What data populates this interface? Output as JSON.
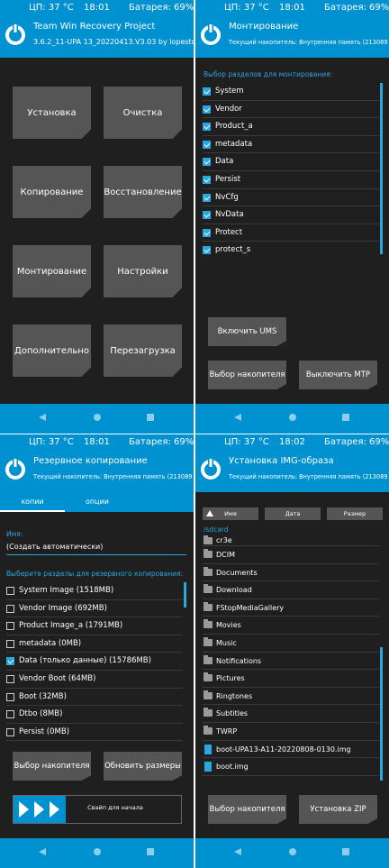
{
  "status": {
    "cpu": "ЦП: 37 °C",
    "battery": "Батарея: 69%",
    "battery_plus": "Батарея: 69%+",
    "time1": "18:01",
    "time2": "18:01",
    "time3": "18:01",
    "time4": "18:02"
  },
  "colors": {
    "accent": "#0091d1",
    "background": "#1f1f1f",
    "button": "#555555"
  },
  "main": {
    "title": "Team Win Recovery Project",
    "subtitle": "3.6.2_11-UPA 13_20220413.V3.03 by lopestom",
    "buttons": [
      "Установка",
      "Очистка",
      "Копирование",
      "Восстановление",
      "Монтирование",
      "Настройки",
      "Дополнительно",
      "Перезагрузка"
    ]
  },
  "mount": {
    "title": "Монтирование",
    "storage": "Текущий накопитель: Внутренняя память (213089 МБ)",
    "section_label": "Выбор разделов для монтирования:",
    "partitions": [
      "System",
      "Vendor",
      "Product_a",
      "metadata",
      "Data",
      "Persist",
      "NvCfg",
      "NvData",
      "Protect",
      "protect_s"
    ],
    "ums_button": "Включить UMS",
    "select_storage_button": "Выбор накопителя",
    "mtp_button": "Выключить MTP"
  },
  "backup": {
    "title": "Резервное копирование",
    "storage": "Текущий накопитель: Внутренняя память (213089 МБ)",
    "tabs": [
      "копии",
      "опции"
    ],
    "name_label": "Имя:",
    "name_value": "(Создать автоматически)",
    "section_label": "Выберите разделы для резервного копирования:",
    "partitions": [
      "System Image (1518MB)",
      "Vendor Image (692MB)",
      "Product Image_a (1791MB)",
      "metadata (0MB)",
      "Data (только данные) (15786MB)",
      "Vendor Boot (64MB)",
      "Boot (32MB)",
      "Dtbo (8MB)",
      "Persist (0MB)"
    ],
    "select_storage_button": "Выбор накопителя",
    "refresh_button": "Обновить размеры",
    "swipe_text": "Свайп для начала"
  },
  "img": {
    "title": "Установка IMG-образа",
    "storage": "Текущий накопитель: Внутренняя память (213089 МБ)",
    "sort": [
      "Имя",
      "Дата",
      "Размер"
    ],
    "path": "/sdcard",
    "folders": [
      "cr3e",
      "DCIM",
      "Documents",
      "Download",
      "FStopMediaGallery",
      "Movies",
      "Music",
      "Notifications",
      "Pictures",
      "Ringtones",
      "Subtitles",
      "TWRP"
    ],
    "files": [
      "boot-UPA13-A11-20220808-0130.img",
      "boot.img"
    ],
    "select_storage_button": "Выбор накопителя",
    "install_button": "Установка ZIP"
  }
}
